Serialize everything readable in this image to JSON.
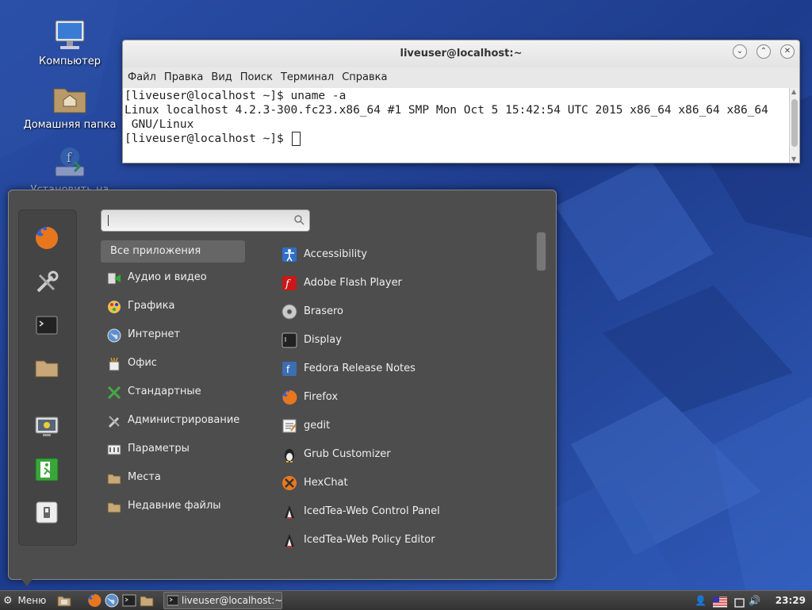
{
  "desktop": {
    "icons": [
      {
        "label": "Компьютер",
        "icon": "computer-icon"
      },
      {
        "label": "Домашняя папка",
        "icon": "home-folder-icon"
      },
      {
        "label": "Установить на жесткий диск",
        "icon": "install-icon"
      }
    ]
  },
  "terminal": {
    "title": "liveuser@localhost:~",
    "menu": [
      "Файл",
      "Правка",
      "Вид",
      "Поиск",
      "Терминал",
      "Справка"
    ],
    "lines": [
      "[liveuser@localhost ~]$ uname -a",
      "Linux localhost 4.2.3-300.fc23.x86_64 #1 SMP Mon Oct 5 15:42:54 UTC 2015 x86_64 x86_64 x86_64",
      " GNU/Linux",
      "[liveuser@localhost ~]$ "
    ],
    "controls": [
      "minimize",
      "maximize",
      "close"
    ]
  },
  "menu": {
    "search_value": "",
    "favorites": [
      "firefox-icon",
      "tools-icon",
      "terminal-icon",
      "folder-icon",
      "lock-screen-icon",
      "logout-icon",
      "shutdown-icon"
    ],
    "categories": [
      {
        "label": "Все приложения",
        "selected": true
      },
      {
        "label": "Аудио и видео",
        "icon": "multimedia-icon"
      },
      {
        "label": "Графика",
        "icon": "graphics-icon"
      },
      {
        "label": "Интернет",
        "icon": "internet-icon"
      },
      {
        "label": "Офис",
        "icon": "office-icon"
      },
      {
        "label": "Стандартные",
        "icon": "accessories-icon"
      },
      {
        "label": "Администрирование",
        "icon": "administration-icon"
      },
      {
        "label": "Параметры",
        "icon": "preferences-icon"
      },
      {
        "label": "Места",
        "icon": "places-icon"
      },
      {
        "label": "Недавние файлы",
        "icon": "recent-files-icon"
      }
    ],
    "apps": [
      {
        "label": "Accessibility",
        "icon": "accessibility-icon"
      },
      {
        "label": "Adobe Flash Player",
        "icon": "flash-icon"
      },
      {
        "label": "Brasero",
        "icon": "disc-icon"
      },
      {
        "label": "Display",
        "icon": "display-icon"
      },
      {
        "label": "Fedora Release Notes",
        "icon": "fedora-icon"
      },
      {
        "label": "Firefox",
        "icon": "firefox-icon"
      },
      {
        "label": "gedit",
        "icon": "text-editor-icon"
      },
      {
        "label": "Grub Customizer",
        "icon": "tux-icon"
      },
      {
        "label": "HexChat",
        "icon": "hexchat-icon"
      },
      {
        "label": "IcedTea-Web Control Panel",
        "icon": "java-icon"
      },
      {
        "label": "IcedTea-Web Policy Editor",
        "icon": "java-icon"
      }
    ]
  },
  "taskbar": {
    "menu_label": "Меню",
    "window_label": "liveuser@localhost:~",
    "clock": "23:29",
    "launchers": [
      "show-desktop-icon",
      "firefox-icon",
      "network-icon",
      "terminal-icon",
      "files-icon"
    ],
    "tray": [
      "user-icon",
      "us-flag-icon",
      "window-icon",
      "volume-icon"
    ]
  },
  "colors": {
    "desktop_bg": "#1e3c8c",
    "menu_bg": "#4d4d4d",
    "selected_cat": "#666666"
  }
}
